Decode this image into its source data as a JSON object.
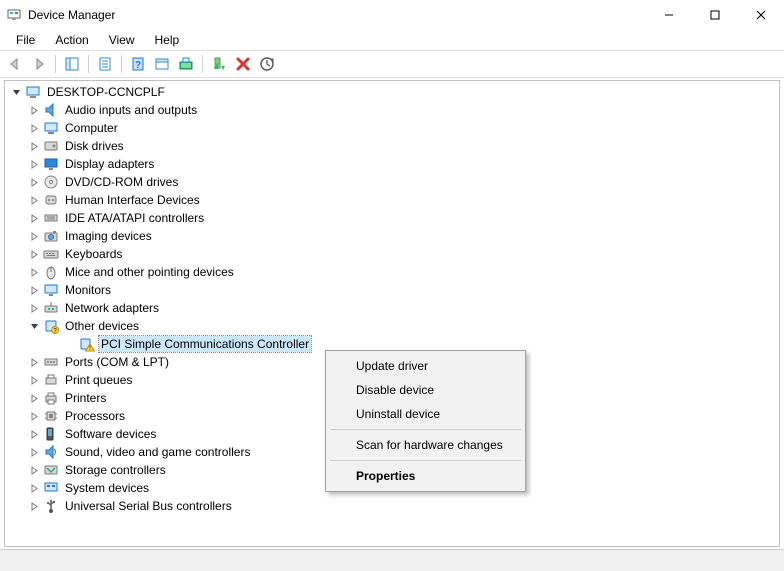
{
  "window": {
    "title": "Device Manager"
  },
  "menubar": {
    "file": "File",
    "action": "Action",
    "view": "View",
    "help": "Help"
  },
  "tree": {
    "root": "DESKTOP-CCNCPLF",
    "items": [
      {
        "label": "Audio inputs and outputs",
        "icon": "audio"
      },
      {
        "label": "Computer",
        "icon": "computer"
      },
      {
        "label": "Disk drives",
        "icon": "disk"
      },
      {
        "label": "Display adapters",
        "icon": "display"
      },
      {
        "label": "DVD/CD-ROM drives",
        "icon": "dvd"
      },
      {
        "label": "Human Interface Devices",
        "icon": "hid"
      },
      {
        "label": "IDE ATA/ATAPI controllers",
        "icon": "ide"
      },
      {
        "label": "Imaging devices",
        "icon": "imaging"
      },
      {
        "label": "Keyboards",
        "icon": "keyboard"
      },
      {
        "label": "Mice and other pointing devices",
        "icon": "mouse"
      },
      {
        "label": "Monitors",
        "icon": "monitor"
      },
      {
        "label": "Network adapters",
        "icon": "network"
      },
      {
        "label": "Other devices",
        "icon": "other",
        "expanded": true,
        "children": [
          {
            "label": "PCI Simple Communications Controller",
            "icon": "warning",
            "selected": true
          }
        ]
      },
      {
        "label": "Ports (COM & LPT)",
        "icon": "port"
      },
      {
        "label": "Print queues",
        "icon": "printqueue"
      },
      {
        "label": "Printers",
        "icon": "printer"
      },
      {
        "label": "Processors",
        "icon": "cpu"
      },
      {
        "label": "Software devices",
        "icon": "software"
      },
      {
        "label": "Sound, video and game controllers",
        "icon": "sound"
      },
      {
        "label": "Storage controllers",
        "icon": "storage"
      },
      {
        "label": "System devices",
        "icon": "system"
      },
      {
        "label": "Universal Serial Bus controllers",
        "icon": "usb"
      }
    ]
  },
  "context_menu": {
    "update": "Update driver",
    "disable": "Disable device",
    "uninstall": "Uninstall device",
    "scan": "Scan for hardware changes",
    "properties": "Properties"
  }
}
